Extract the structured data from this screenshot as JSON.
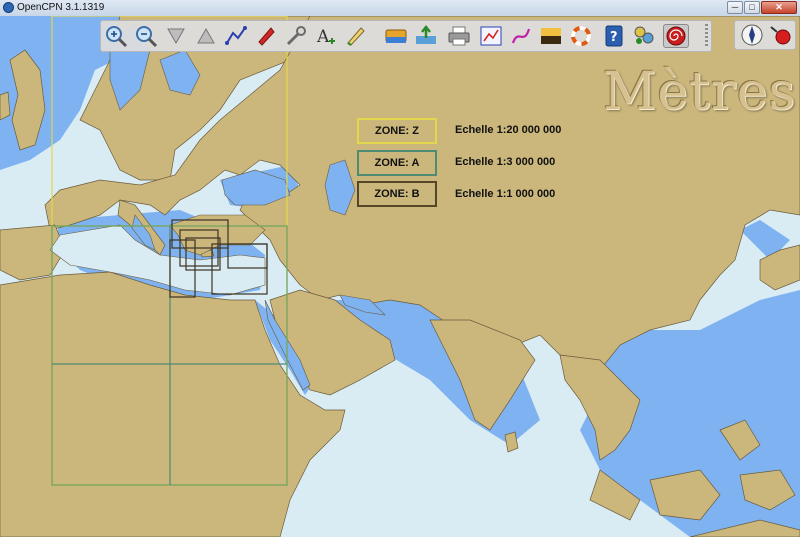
{
  "window": {
    "title": "OpenCPN 3.1.1319",
    "minimize": "─",
    "maximize": "□",
    "close": "✕"
  },
  "toolbar": {
    "buttons": [
      {
        "name": "zoom-in-icon"
      },
      {
        "name": "zoom-out-icon"
      },
      {
        "name": "scale-in-icon"
      },
      {
        "name": "scale-out-icon"
      },
      {
        "name": "route-icon"
      },
      {
        "name": "follow-ship-icon"
      },
      {
        "name": "settings-wrench-icon"
      },
      {
        "name": "text-icon"
      },
      {
        "name": "current-tide-icon"
      },
      {
        "name": "chart-quilt-icon"
      },
      {
        "name": "ais-icon"
      },
      {
        "name": "print-icon"
      },
      {
        "name": "route-manager-icon"
      },
      {
        "name": "track-icon"
      },
      {
        "name": "color-scheme-icon"
      },
      {
        "name": "mob-icon"
      },
      {
        "name": "help-icon"
      },
      {
        "name": "plugin-dashboard-icon"
      },
      {
        "name": "spiral-record-icon"
      }
    ],
    "right_buttons": [
      {
        "name": "compass-icon"
      },
      {
        "name": "gps-status-icon"
      }
    ]
  },
  "map": {
    "units_label": "Mètres",
    "colors": {
      "land": "#cbb67c",
      "shallow": "#7fb2f0",
      "deep": "#d9ebf3"
    },
    "zones": [
      {
        "label": "ZONE:  Z",
        "scale": "Echelle   1:20 000 000",
        "color": "#e3d84c"
      },
      {
        "label": "ZONE:  A",
        "scale": "Echelle   1:3 000 000",
        "color": "#4f8a73"
      },
      {
        "label": "ZONE:  B",
        "scale": "Echelle   1:1 000 000",
        "color": "#55462a"
      }
    ]
  }
}
